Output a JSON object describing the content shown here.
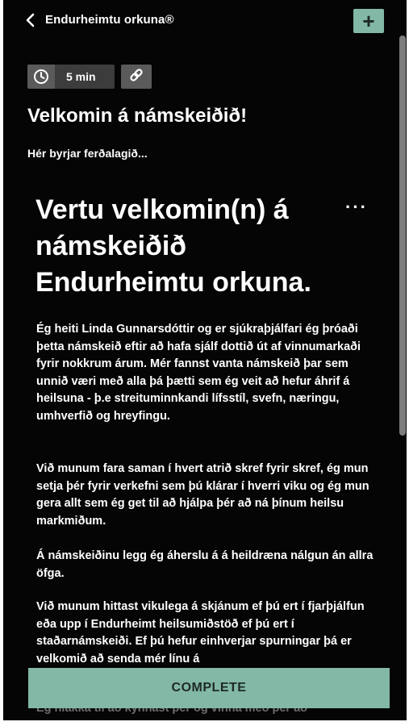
{
  "header": {
    "title": "Endurheimtu orkuna®",
    "back_icon": "chevron-left-icon",
    "add_icon": "plus-icon",
    "add_label": "+"
  },
  "meta": {
    "duration": "5 min",
    "duration_icon": "clock-icon",
    "link_icon": "link-icon"
  },
  "lesson": {
    "heading": "Velkomin á námskeiðið!",
    "subheading": "Hér byrjar ferðalagið..."
  },
  "content": {
    "title": "Vertu velkomin(n) á námskeiðið Endurheimtu orkuna.",
    "more_label": "···",
    "paragraphs": [
      "Ég heiti Linda Gunnarsdóttir og er sjúkraþjálfari ég þróaði þetta námskeið eftir að hafa sjálf dottið út af vinnumarkaði fyrir nokkrum árum. Mér fannst vanta námskeið þar sem unnið væri með alla þá þætti sem ég veit að hefur áhrif á heilsuna - þ.e streituminnkandi lífsstíl, svefn, næringu, umhverfið og hreyfingu.",
      "Við munum fara saman í hvert atrið skref fyrir skref, ég mun setja þér fyrir verkefni sem þú klárar í hverri viku og ég mun gera allt sem ég get til að hjálpa þér að ná þínum heilsu markmiðum.",
      "Á námskeiðinu legg ég áherslu á á heildræna nálgun án allra öfga.",
      "Við munum hittast vikulega á skjánum ef þú ert í fjarþjálfun eða upp í Endurheimt heilsumiðstöð ef þú ert í staðarnámskeiði. Ef þú hefur einhverjar spurningar þá er velkomið að senda mér línu á",
      "Ég hlakka til að kynnast þér og vinna með þér að"
    ]
  },
  "footer": {
    "complete_label": "COMPLETE"
  },
  "colors": {
    "background": "#050505",
    "accent": "#82b8a5",
    "chip": "#3c3c3c",
    "chip_icon_bg": "#5a5a5a",
    "scrollbar": "#7d7d7d"
  }
}
